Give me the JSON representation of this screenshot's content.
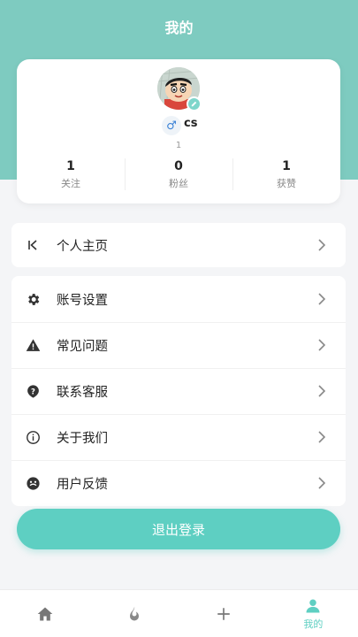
{
  "header": {
    "title": "我的"
  },
  "profile": {
    "username": "cs",
    "user_id": "1",
    "gender_icon": "male-icon",
    "stats": [
      {
        "value": "1",
        "label": "关注"
      },
      {
        "value": "0",
        "label": "粉丝"
      },
      {
        "value": "1",
        "label": "获赞"
      }
    ]
  },
  "menu_single": {
    "label": "个人主页",
    "icon": "profile-page-icon"
  },
  "menu_items": [
    {
      "label": "账号设置",
      "icon": "gear-icon"
    },
    {
      "label": "常见问题",
      "icon": "warning-icon"
    },
    {
      "label": "联系客服",
      "icon": "help-icon"
    },
    {
      "label": "关于我们",
      "icon": "info-icon"
    },
    {
      "label": "用户反馈",
      "icon": "feedback-icon"
    }
  ],
  "logout_label": "退出登录",
  "tabbar": {
    "tabs": [
      {
        "icon": "home-icon",
        "label": ""
      },
      {
        "icon": "fire-icon",
        "label": ""
      },
      {
        "icon": "plus-icon",
        "label": ""
      },
      {
        "icon": "user-icon",
        "label": "我的"
      }
    ]
  },
  "colors": {
    "accent": "#5ecfc2",
    "header_bg": "#7ecbc0"
  }
}
